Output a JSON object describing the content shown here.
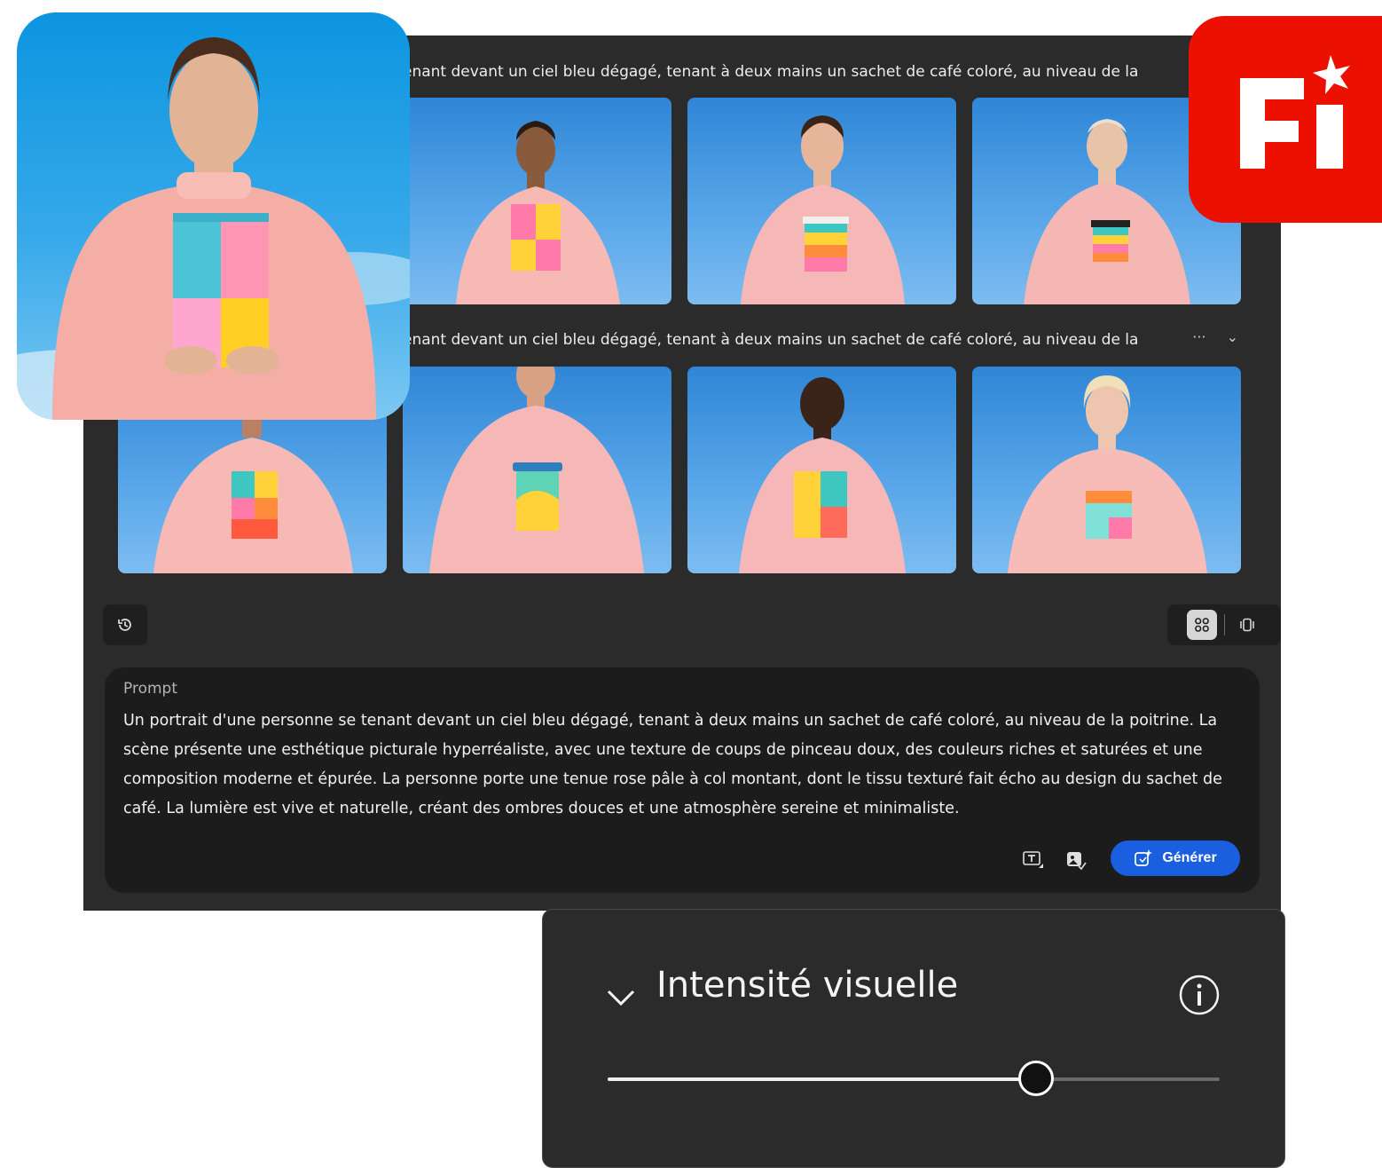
{
  "gallery": {
    "rows": [
      {
        "caption": "enant devant un ciel bleu dégagé, tenant à deux mains un sachet de café coloré, au niveau de la"
      },
      {
        "caption": "enant devant un ciel bleu dégagé, tenant à deux mains un sachet de café coloré, au niveau de la",
        "more_label": "···",
        "collapse_label": "⌄"
      }
    ]
  },
  "prompt": {
    "label": "Prompt",
    "text": "Un portrait d'une personne se tenant devant un ciel bleu dégagé, tenant à deux mains un sachet de café coloré, au niveau de la poitrine. La scène présente une esthétique picturale hyperréaliste, avec une texture de coups de pinceau doux, des couleurs riches et saturées et une composition moderne et épurée. La personne porte une tenue rose pâle à col montant, dont le tissu texturé fait écho au design du sachet de café. La lumière est vive et naturelle, créant des ombres douces et une atmosphère sereine et minimaliste.",
    "generate_label": "Générer"
  },
  "intensity": {
    "title": "Intensité visuelle",
    "value_fraction": 0.7
  },
  "colors": {
    "accent": "#1a5fe0",
    "logo": "#eb1000",
    "panel": "#2b2b2b",
    "prompt_bg": "#1c1c1c"
  }
}
